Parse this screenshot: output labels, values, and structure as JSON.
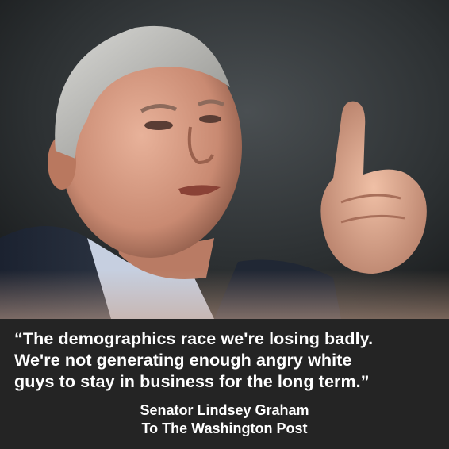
{
  "photo": {
    "subject": "man-pointing-finger-upward"
  },
  "quote": {
    "lines": [
      "“The demographics race we're losing badly.",
      "We're not generating enough angry white",
      "guys to stay in business for the long term.”"
    ]
  },
  "attribution": {
    "name": "Senator Lindsey Graham",
    "source": "To The Washington Post"
  },
  "colors": {
    "caption_bg": "#242424",
    "text": "#ffffff"
  }
}
